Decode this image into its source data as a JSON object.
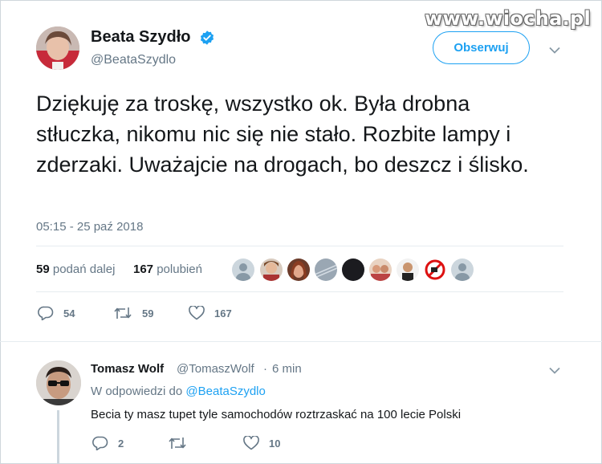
{
  "watermark": "www.wiocha.pl",
  "tweet": {
    "author_name": "Beata Szydło",
    "author_handle": "@BeataSzydlo",
    "follow_label": "Obserwuj",
    "text": "Dziękuję za troskę, wszystko ok. Była drobna stłuczka, nikomu nic się nie stało. Rozbite lampy i zderzaki. Uważajcie na drogach, bo deszcz i ślisko.",
    "timestamp": "05:15 - 25 paź 2018",
    "retweets_count": "59",
    "retweets_label": "podań dalej",
    "likes_count": "167",
    "likes_label": "polubień",
    "actions": {
      "replies": "54",
      "retweets": "59",
      "likes": "167"
    }
  },
  "liker_avatars": [
    "default-user-icon",
    "user-avatar",
    "user-avatar",
    "pattern-avatar",
    "dark-avatar",
    "user-avatar",
    "user-avatar",
    "user-avatar",
    "no-symbol-avatar",
    "default-user-icon"
  ],
  "reply": {
    "author_name": "Tomasz Wolf",
    "author_handle": "@TomaszWolf",
    "separator": "·",
    "time": "6 min",
    "reply_prefix": "W odpowiedzi do",
    "reply_to": "@BeataSzydlo",
    "text": "Becia ty masz tupet tyle samochodów roztrzaskać na 100 lecie Polski",
    "actions": {
      "replies": "2",
      "retweets": "",
      "likes": "10"
    }
  },
  "colors": {
    "accent": "#1da1f2",
    "secondary_text": "#657786",
    "primary_text": "#14171a",
    "divider": "#e6ecf0"
  }
}
